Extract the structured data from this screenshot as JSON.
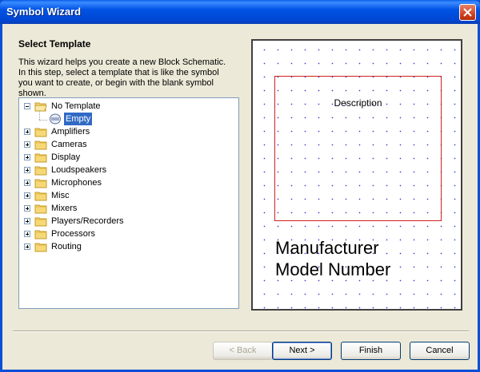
{
  "window": {
    "title": "Symbol Wizard"
  },
  "page": {
    "heading": "Select Template",
    "description": "This wizard helps you create a new Block Schematic. In this step, select a template that is like the symbol you want to create, or begin with the blank symbol shown."
  },
  "tree": {
    "root": {
      "label": "No Template",
      "expanded": true,
      "children": [
        {
          "label": "Empty",
          "selected": true
        }
      ]
    },
    "folders": [
      "Amplifiers",
      "Cameras",
      "Display",
      "Loudspeakers",
      "Microphones",
      "Misc",
      "Mixers",
      "Players/Recorders",
      "Processors",
      "Routing"
    ]
  },
  "preview": {
    "description": "Description",
    "manufacturer": "Manufacturer",
    "model": "Model Number"
  },
  "buttons": {
    "back": "< Back",
    "next": "Next >",
    "finish": "Finish",
    "cancel": "Cancel"
  },
  "colors": {
    "title_bar": "#0053e5",
    "selection": "#316ac5",
    "symbol_border": "#d02020",
    "grid_dot": "#3a3ad0"
  }
}
